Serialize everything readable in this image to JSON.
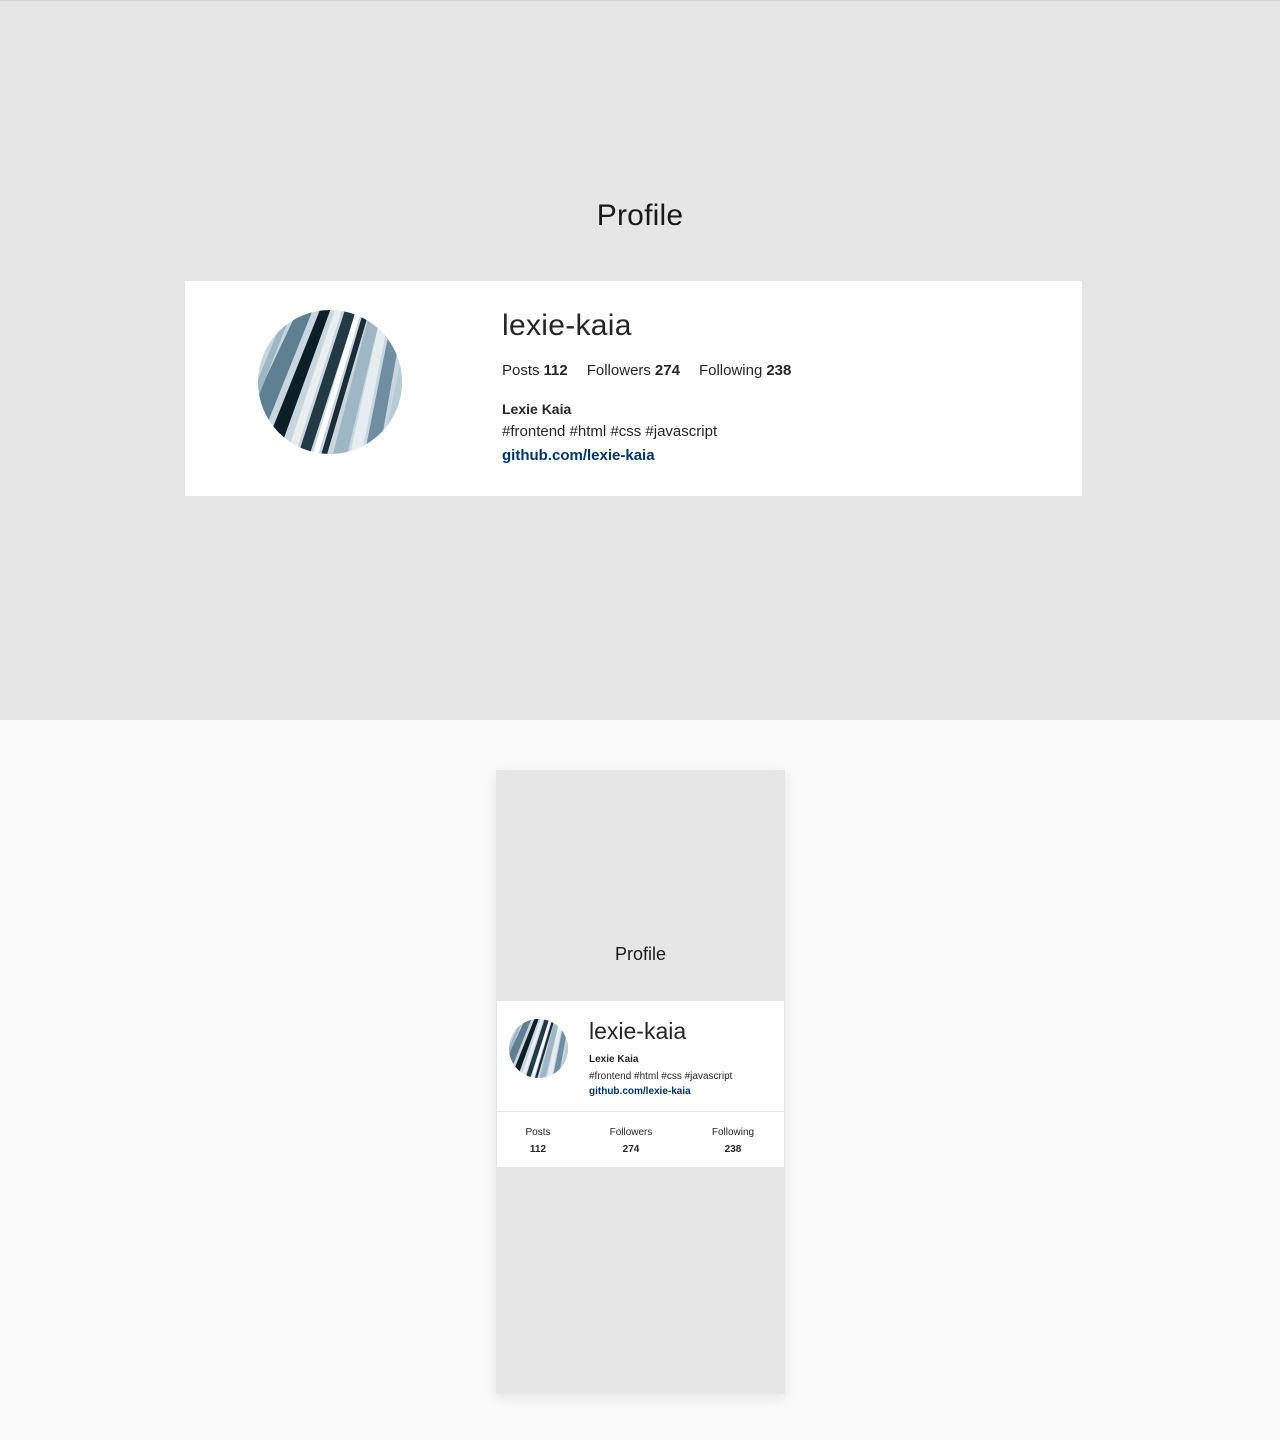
{
  "page_title": "Profile",
  "profile": {
    "username": "lexie-kaia",
    "full_name": "Lexie Kaia",
    "bio": "#frontend #html #css #javascript",
    "link": "github.com/lexie-kaia",
    "avatar_icon": "abstract-stripes-avatar",
    "stats": [
      {
        "label": "Posts",
        "value": "112"
      },
      {
        "label": "Followers",
        "value": "274"
      },
      {
        "label": "Following",
        "value": "238"
      }
    ]
  },
  "colors": {
    "page_bg": "#e6e6e6",
    "card_bg": "#ffffff",
    "link": "#003569",
    "outer_bg": "#f9f9f9"
  }
}
